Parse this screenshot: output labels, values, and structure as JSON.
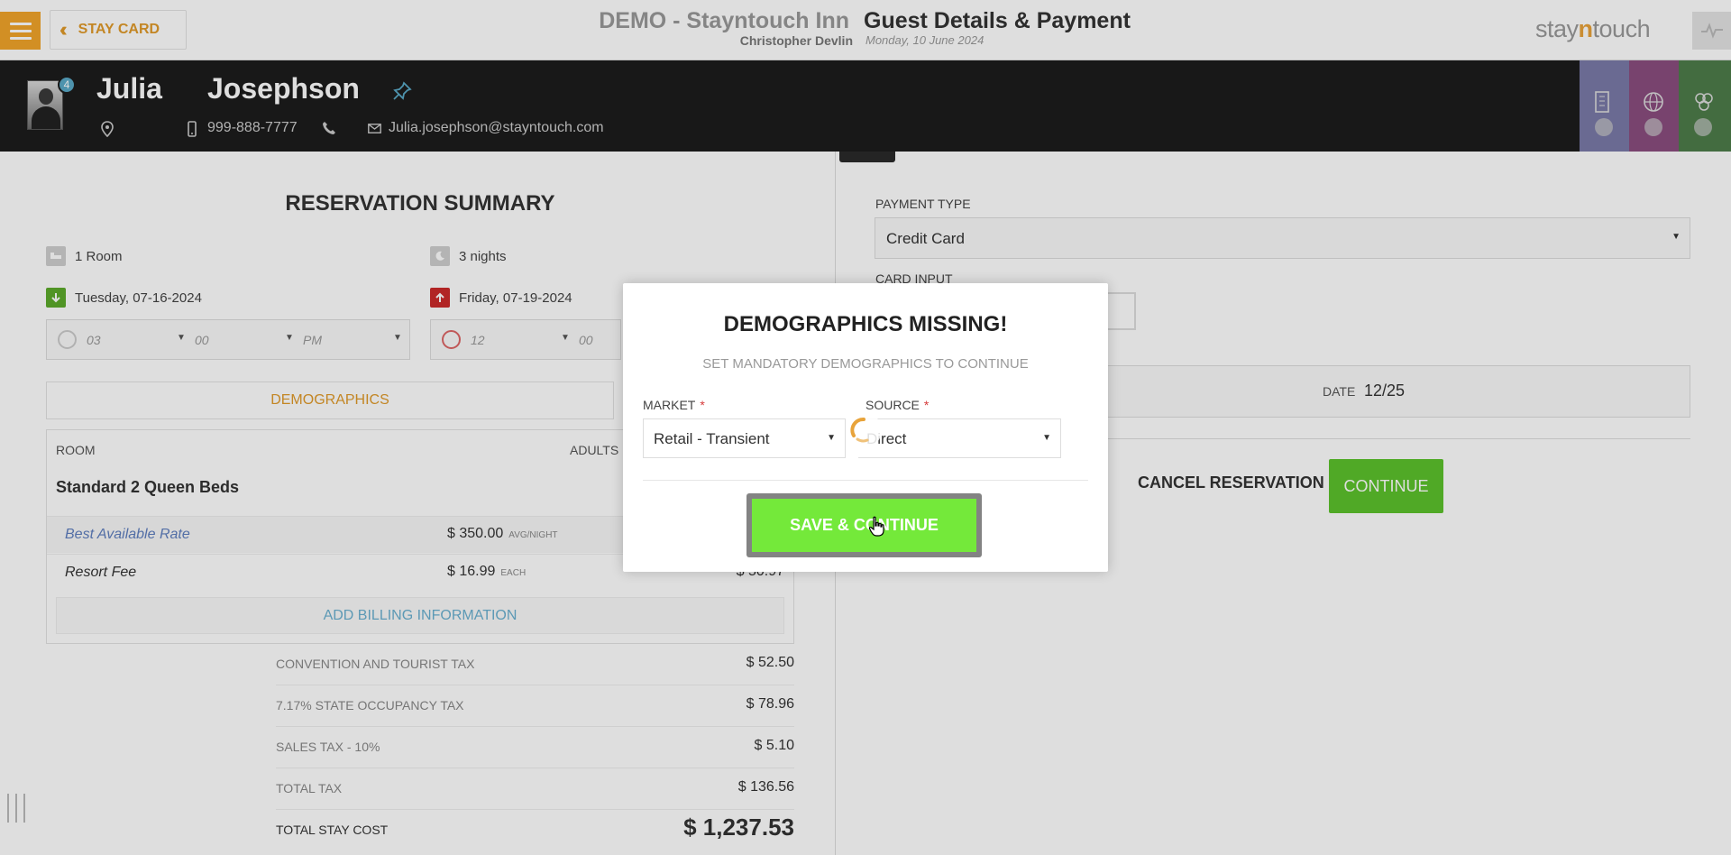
{
  "topbar": {
    "stay_card_label": "STAY CARD",
    "hotel_name": "DEMO - Stayntouch Inn",
    "user_name": "Christopher Devlin",
    "page_title": "Guest Details & Payment",
    "date": "Monday, 10 June 2024",
    "brand_pre": "stay",
    "brand_n": "n",
    "brand_post": "touch"
  },
  "guest": {
    "badge_count": "4",
    "first_name": "Julia",
    "last_name": "Josephson",
    "phone": "999-888-7777",
    "email": "Julia.josephson@stayntouch.com"
  },
  "reservation": {
    "title": "RESERVATION SUMMARY",
    "rooms": "1 Room",
    "nights": "3 nights",
    "arrival": "Tuesday, 07-16-2024",
    "departure": "Friday, 07-19-2024",
    "arrival_time": {
      "hour": "03",
      "minute": "00",
      "ampm": "PM"
    },
    "departure_time": {
      "hour": "12",
      "minute": "00"
    },
    "demographics_label": "DEMOGRAPHICS",
    "room_label": "ROOM",
    "adults_label": "ADULTS",
    "room_type": "Standard 2 Queen Beds",
    "rates": [
      {
        "name": "Best Available Rate",
        "amount": "$ 350.00",
        "unit": "AVG/NIGHT",
        "total": ""
      },
      {
        "name": "Resort Fee",
        "amount": "$ 16.99",
        "unit": "EACH",
        "total": "$ 50.97"
      }
    ],
    "add_billing_label": "ADD BILLING INFORMATION",
    "taxes": [
      {
        "label": "CONVENTION AND TOURIST TAX",
        "value": "$ 52.50"
      },
      {
        "label": "7.17% STATE OCCUPANCY TAX",
        "value": "$ 78.96"
      },
      {
        "label": "SALES TAX - 10%",
        "value": "$ 5.10"
      },
      {
        "label": "TOTAL TAX",
        "value": "$ 136.56"
      }
    ],
    "total_label": "TOTAL STAY COST",
    "total_value": "$ 1,237.53"
  },
  "payment": {
    "payment_type_label": "PAYMENT TYPE",
    "payment_type_value": "Credit Card",
    "card_input_label": "CARD INPUT",
    "date_label": "DATE",
    "date_value": "12/25",
    "cancel_label": "CANCEL RESERVATION",
    "continue_label": "CONTINUE"
  },
  "modal": {
    "title": "DEMOGRAPHICS MISSING!",
    "subtitle": "SET MANDATORY DEMOGRAPHICS TO CONTINUE",
    "market_label": "MARKET",
    "market_value": "Retail - Transient",
    "source_label": "SOURCE",
    "source_value": "Direct",
    "required_mark": "*",
    "save_label": "SAVE & CONTINUE"
  },
  "colors": {
    "accent_orange": "#f2a52a",
    "continue_green": "#5cc32c",
    "save_green": "#74e93a",
    "link_blue": "#6ab0d0",
    "header_dark": "#1c1c1c"
  },
  "icons": [
    "menu-icon",
    "double-chevron-left-icon",
    "pulse-icon",
    "pin-icon",
    "location-icon",
    "mobile-icon",
    "phone-icon",
    "mail-icon",
    "building-icon",
    "globe-icon",
    "users-icon",
    "magnifier-icon",
    "bed-icon",
    "moon-icon",
    "arrow-down-icon",
    "arrow-up-icon",
    "clock-icon",
    "loading-spinner-icon",
    "hand-cursor-icon"
  ]
}
